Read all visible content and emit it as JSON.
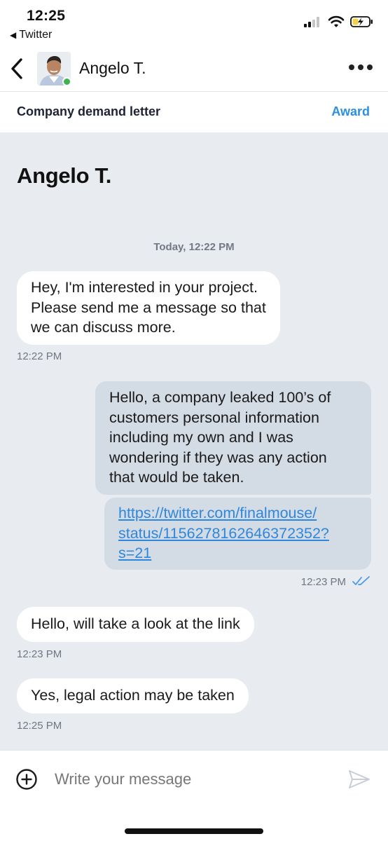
{
  "status_bar": {
    "time": "12:25",
    "back_app": "Twitter"
  },
  "header": {
    "contact_name": "Angelo T.",
    "online": true
  },
  "project": {
    "title": "Company demand letter",
    "award_label": "Award"
  },
  "chat": {
    "heading": "Angelo T.",
    "date_separator": "Today, 12:22 PM",
    "messages": [
      {
        "direction": "incoming",
        "lines": [
          "Hey, I'm interested in your project.",
          "Please send me a message so that",
          "we can discuss more."
        ],
        "time": "12:22 PM"
      },
      {
        "direction": "outgoing",
        "lines": [
          "Hello, a company leaked 100’s of",
          "customers personal information",
          "including my own and I was",
          "wondering if they was any action",
          "that would be taken."
        ]
      },
      {
        "direction": "outgoing",
        "type": "link",
        "lines": [
          "https://twitter.com/finalmouse/",
          "status/1156278162646372352?",
          "s=21"
        ],
        "time": "12:23 PM",
        "read": true
      },
      {
        "direction": "incoming",
        "lines": [
          "Hello,  will take a look at the link"
        ],
        "time": "12:23 PM"
      },
      {
        "direction": "incoming",
        "lines": [
          "Yes, legal action may be taken"
        ],
        "time": "12:25 PM"
      }
    ]
  },
  "composer": {
    "placeholder": "Write your message"
  },
  "colors": {
    "accent": "#2d8fe2",
    "chat_background": "#e8ebef",
    "outgoing_bubble": "#d3dbe4",
    "online": "#3fb34f"
  },
  "icons": {
    "back": "chevron-left-icon",
    "more": "more-horizontal-icon",
    "add": "plus-circle-icon",
    "send": "send-icon",
    "read_receipt": "double-check-icon"
  }
}
